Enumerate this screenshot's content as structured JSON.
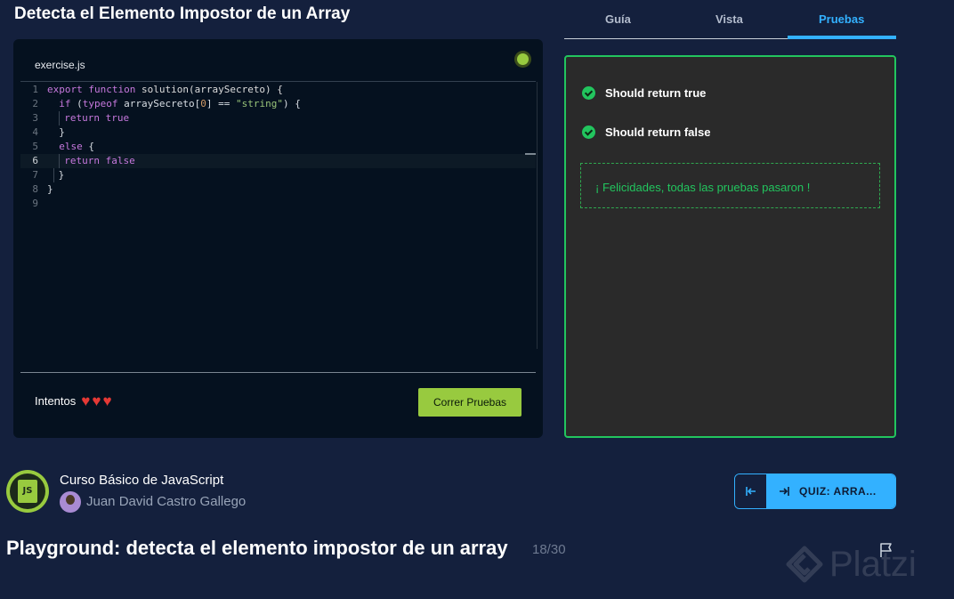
{
  "challenge": {
    "title": "Detecta el Elemento Impostor de un Array"
  },
  "editor": {
    "filename": "exercise.js",
    "active_line": 6,
    "lines": [
      "export function solution(arraySecreto) {",
      "  if (typeof arraySecreto[0] == \"string\") {",
      "    return true",
      "  }",
      "  else {",
      "    return false",
      "  }",
      "}",
      ""
    ],
    "attempts_label": "Intentos",
    "attempts_remaining": 3,
    "run_button": "Correr Pruebas"
  },
  "tabs": [
    {
      "label": "Guía",
      "active": false
    },
    {
      "label": "Vista",
      "active": false
    },
    {
      "label": "Pruebas",
      "active": true
    }
  ],
  "results": {
    "tests": [
      {
        "label": "Should return true",
        "status": "passed",
        "icon": "check-circle-icon"
      },
      {
        "label": "Should return false",
        "status": "passed",
        "icon": "check-circle-icon"
      }
    ],
    "success_message": "¡ Felicidades, todas las pruebas pasaron !"
  },
  "course": {
    "name": "Curso Básico de JavaScript",
    "author": "Juan David Castro Gallego",
    "logo_text": "JS"
  },
  "navigation": {
    "prev_icon": "arrow-left-to-line-icon",
    "next_icon": "arrow-right-to-line-icon",
    "next_label": "QUIZ: ARRA..."
  },
  "class_info": {
    "title": "Playground: detecta el elemento impostor de un array",
    "progress": "18/30"
  },
  "brand": {
    "name": "Platzi"
  },
  "colors": {
    "background": "#14203d",
    "accent": "#33b1ff",
    "success": "#22c55e",
    "run_button": "#98ca3f",
    "heart": "#e53935"
  }
}
